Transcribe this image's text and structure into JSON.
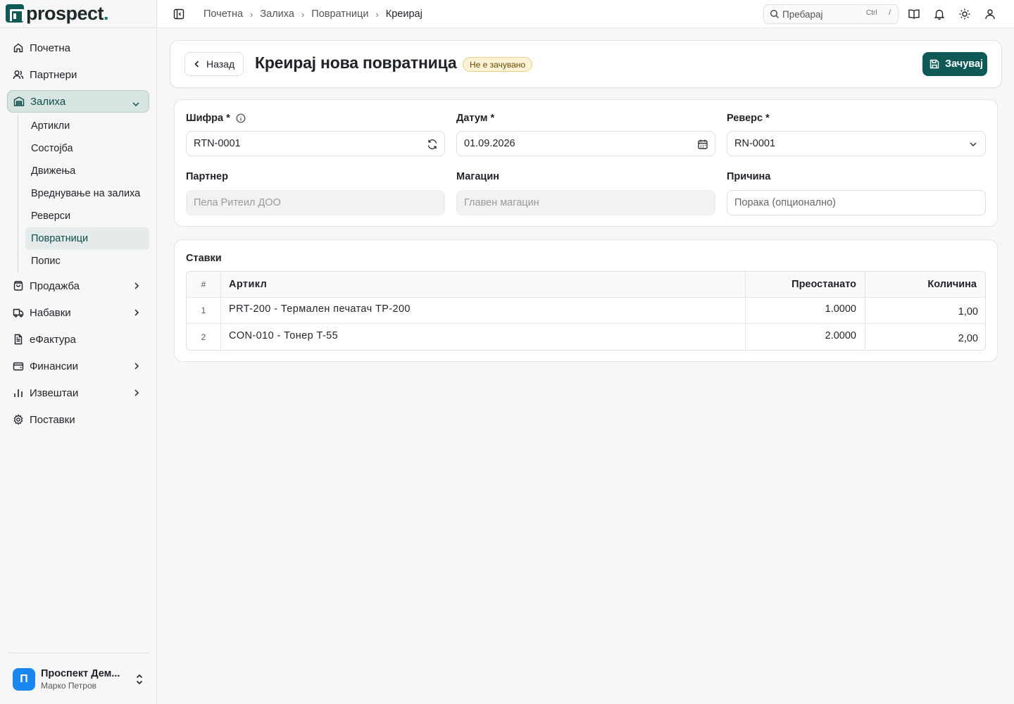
{
  "app": {
    "logo_text": "prospect",
    "logo_dot": "."
  },
  "sidebar": {
    "items": [
      {
        "label": "Почетна",
        "icon": "home-icon"
      },
      {
        "label": "Партнери",
        "icon": "users-icon"
      },
      {
        "label": "Залиха",
        "icon": "warehouse-icon",
        "expanded": true,
        "active": true
      },
      {
        "label": "Продажба",
        "icon": "shopping-bag-icon",
        "has_children": true
      },
      {
        "label": "Набавки",
        "icon": "truck-icon",
        "has_children": true
      },
      {
        "label": "еФактура",
        "icon": "file-text-icon"
      },
      {
        "label": "Финансии",
        "icon": "wallet-icon",
        "has_children": true
      },
      {
        "label": "Извештаи",
        "icon": "bar-chart-icon",
        "has_children": true
      },
      {
        "label": "Поставки",
        "icon": "gear-icon"
      }
    ],
    "subitems": [
      {
        "label": "Артикли"
      },
      {
        "label": "Состојба"
      },
      {
        "label": "Движења"
      },
      {
        "label": "Вреднување на залиха"
      },
      {
        "label": "Реверси"
      },
      {
        "label": "Повратници",
        "active": true
      },
      {
        "label": "Попис"
      }
    ],
    "user": {
      "initial": "П",
      "name": "Проспект Дем...",
      "subtitle": "Марко Петров"
    }
  },
  "topbar": {
    "breadcrumbs": [
      "Почетна",
      "Залиха",
      "Повратници",
      "Креирај"
    ],
    "search_placeholder": "Пребарај",
    "search_kbd_1": "Ctrl",
    "search_kbd_2": "/"
  },
  "header": {
    "back_label": "Назад",
    "title": "Креирај нова повратница",
    "status_badge": "Не е зачувано",
    "save_label": "Зачувај"
  },
  "form": {
    "code_label": "Шифра *",
    "code_value": "RTN-0001",
    "date_label": "Датум *",
    "date_value": "01.09.2026",
    "reverse_label": "Реверс *",
    "reverse_value": "RN-0001",
    "partner_label": "Партнер",
    "partner_value": "Пела Ритеил ДОО",
    "warehouse_label": "Магацин",
    "warehouse_value": "Главен магацин",
    "reason_label": "Причина",
    "reason_placeholder": "Порака (опционално)"
  },
  "items": {
    "title": "Ставки",
    "columns": {
      "num": "#",
      "article": "Артикл",
      "remaining": "Преостанато",
      "quantity": "Количина"
    },
    "rows": [
      {
        "num": "1",
        "article": "PRT-200 - Термален печатач TP-200",
        "remaining": "1.0000",
        "quantity": "1,00"
      },
      {
        "num": "2",
        "article": "CON-010 - Тонер T-55",
        "remaining": "2.0000",
        "quantity": "2,00"
      }
    ]
  },
  "colors": {
    "accent": "#0f5a57",
    "badge_bg": "#fbf1d4",
    "avatar": "#1a86f0"
  }
}
